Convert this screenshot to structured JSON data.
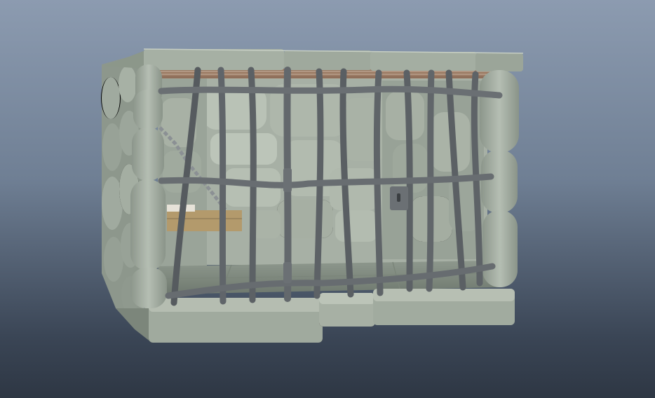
{
  "scene": {
    "subject": "stone-jail-cell-3d-model",
    "colors": {
      "bg_top": "#8c9bb0",
      "bg_bottom": "#2e3744",
      "stone": "#9aa499",
      "stone_light": "#b4bdb2",
      "stone_dark": "#737d72",
      "bar": "#5f6468",
      "bar_light": "#7d8286",
      "wood": "#b39a6c",
      "ceiling_wood": "#9a7a63"
    }
  }
}
